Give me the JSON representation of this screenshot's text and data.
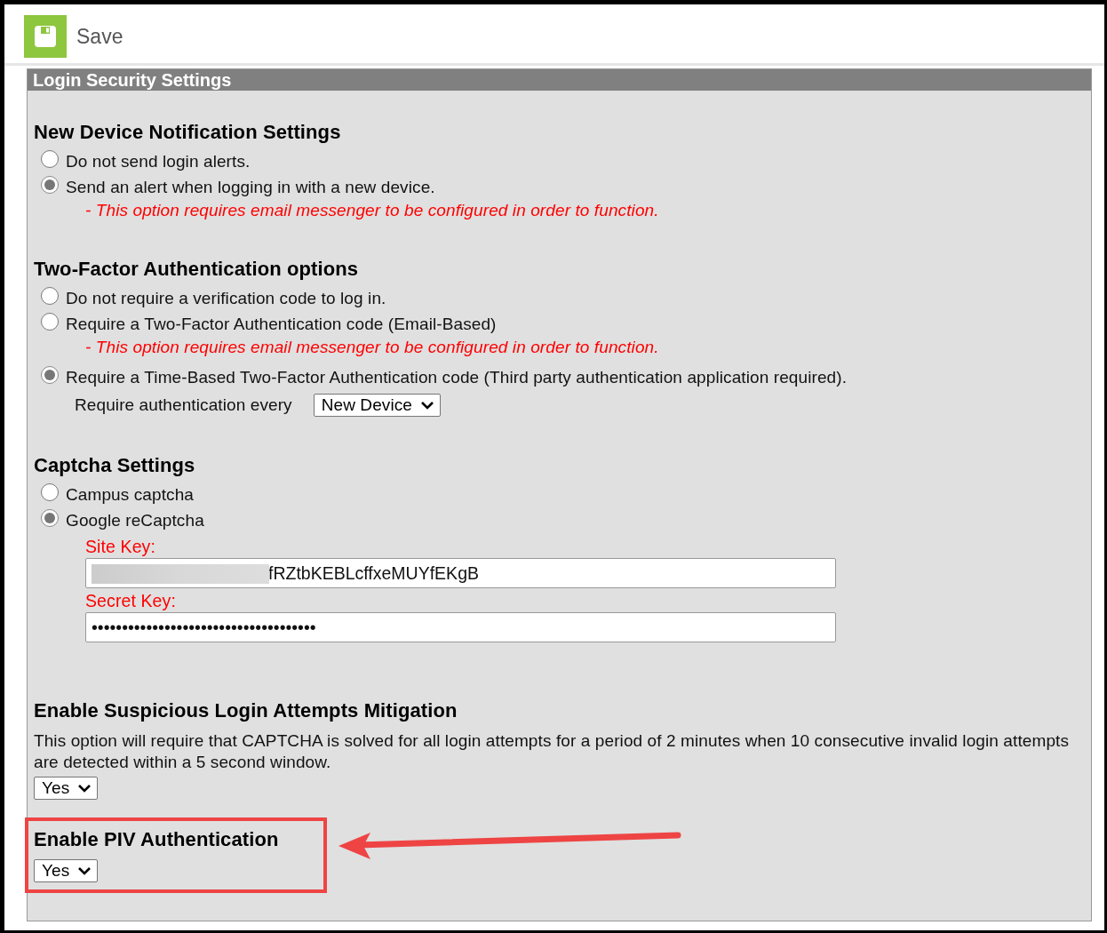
{
  "toolbar": {
    "save_label": "Save"
  },
  "panel": {
    "title": "Login Security Settings"
  },
  "sections": [
    {
      "kind": "radios",
      "heading": "New Device Notification Settings",
      "options": [
        {
          "label": "Do not send login alerts.",
          "selected": false
        },
        {
          "label": "Send an alert when logging in with a new device.",
          "selected": true,
          "note": "- This option requires email messenger to be configured in order to function."
        }
      ]
    },
    {
      "kind": "radios",
      "heading": "Two-Factor Authentication options",
      "options": [
        {
          "label": "Do not require a verification code to log in.",
          "selected": false
        },
        {
          "label": "Require a Two-Factor Authentication code (Email-Based)",
          "selected": false,
          "note": "- This option requires email messenger to be configured in order to function."
        },
        {
          "label": "Require a Time-Based Two-Factor Authentication code (Third party authentication application required).",
          "selected": true,
          "sub_label": "Require authentication every",
          "sub_select": "New Device"
        }
      ]
    },
    {
      "kind": "radios",
      "heading": "Captcha Settings",
      "options": [
        {
          "label": "Campus captcha",
          "selected": false
        },
        {
          "label": "Google reCaptcha",
          "selected": true,
          "fields": [
            {
              "label": "Site Key:",
              "value": "fRZtbKEBLcffxeMUYfEKgB",
              "redacted": true
            },
            {
              "label": "Secret Key:",
              "value": "•••••••••••••••••••••••••••••••••••••",
              "redacted": false
            }
          ]
        }
      ]
    },
    {
      "kind": "select",
      "heading": "Enable Suspicious Login Attempts Mitigation",
      "description": "This option will require that CAPTCHA is solved for all login attempts for a period of 2 minutes when 10 consecutive invalid login attempts are detected within a 5 second window.",
      "select": "Yes",
      "highlighted": false
    },
    {
      "kind": "select",
      "heading": "Enable PIV Authentication",
      "select": "Yes",
      "highlighted": true
    }
  ]
}
